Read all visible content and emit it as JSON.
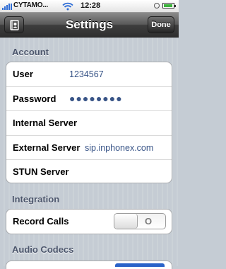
{
  "status_bar": {
    "carrier": "CYTAMO...",
    "time": "12:28",
    "battery_level": 0.9,
    "colors": {
      "signal": "#2d6cd6",
      "battery": "#3db33d"
    }
  },
  "nav": {
    "title": "Settings",
    "done_label": "Done",
    "left_icon": "contacts-book-icon"
  },
  "sections": {
    "account": {
      "header": "Account",
      "user_label": "User",
      "user_value": "1234567",
      "password_label": "Password",
      "password_value": "●●●●●●●●",
      "internal_server_label": "Internal Server",
      "internal_server_value": "",
      "external_server_label": "External Server",
      "external_server_value": "sip.inphonex.com",
      "stun_server_label": "STUN Server",
      "stun_server_value": ""
    },
    "integration": {
      "header": "Integration",
      "record_calls_label": "Record Calls",
      "record_calls_state": "O",
      "record_calls_on": false
    },
    "audio_codecs": {
      "header": "Audio Codecs"
    }
  },
  "colors": {
    "nav_bar": "#3e3e3e",
    "background": "#c5ccd4",
    "section_header": "#4c566c",
    "value_text": "#385487"
  }
}
